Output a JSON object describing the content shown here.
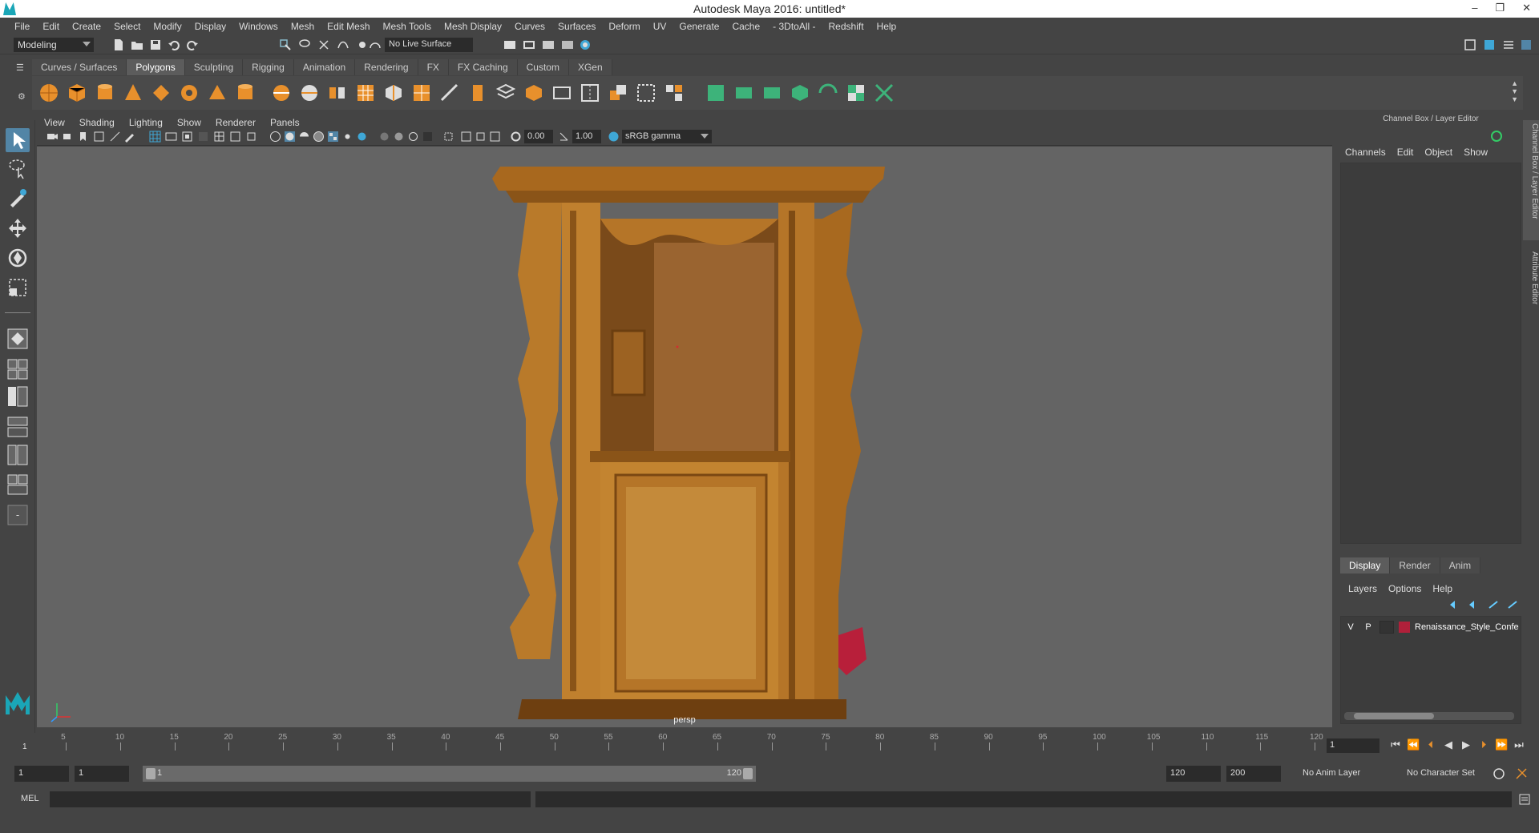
{
  "app": {
    "title": "Autodesk Maya 2016: untitled*"
  },
  "window_buttons": [
    "–",
    "❐",
    "✕"
  ],
  "menubar": [
    "File",
    "Edit",
    "Create",
    "Select",
    "Modify",
    "Display",
    "Windows",
    "Mesh",
    "Edit Mesh",
    "Mesh Tools",
    "Mesh Display",
    "Curves",
    "Surfaces",
    "Deform",
    "UV",
    "Generate",
    "Cache",
    "- 3DtoAll -",
    "Redshift",
    "Help"
  ],
  "statusline": {
    "mode": "Modeling",
    "live_surface": "No Live Surface"
  },
  "shelf": {
    "tabs": [
      "Curves / Surfaces",
      "Polygons",
      "Sculpting",
      "Rigging",
      "Animation",
      "Rendering",
      "FX",
      "FX Caching",
      "Custom",
      "XGen"
    ],
    "active_tab": "Polygons"
  },
  "panel": {
    "menus": [
      "View",
      "Shading",
      "Lighting",
      "Show",
      "Renderer",
      "Panels"
    ],
    "exposure": "0.00",
    "gamma": "1.00",
    "color_space": "sRGB gamma",
    "camera_label": "persp"
  },
  "channel_box": {
    "header": "Channel Box / Layer Editor",
    "menus": [
      "Channels",
      "Edit",
      "Object",
      "Show"
    ],
    "layer_tabs": [
      "Display",
      "Render",
      "Anim"
    ],
    "active_layer_tab": "Display",
    "layer_menus": [
      "Layers",
      "Options",
      "Help"
    ],
    "layer": {
      "v": "V",
      "p": "P",
      "name": "Renaissance_Style_Confe",
      "color": "#b0203a"
    }
  },
  "side_tabs": [
    "Channel Box / Layer Editor",
    "Attribute Editor"
  ],
  "timeline": {
    "ticks": [
      5,
      10,
      15,
      20,
      25,
      30,
      35,
      40,
      45,
      50,
      55,
      60,
      65,
      70,
      75,
      80,
      85,
      90,
      95,
      100,
      105,
      110,
      115,
      120
    ],
    "start_label": "1",
    "current_frame": "1"
  },
  "range": {
    "start": "1",
    "start2": "1",
    "inner_start": "1",
    "inner_end": "120",
    "end": "120",
    "end2": "200",
    "anim_layer": "No Anim Layer",
    "character_set": "No Character Set"
  },
  "cmdline": {
    "label": "MEL"
  },
  "colors": {
    "accent": "#5285a6",
    "wood": "#b97a2a",
    "viewport": "#646464"
  }
}
